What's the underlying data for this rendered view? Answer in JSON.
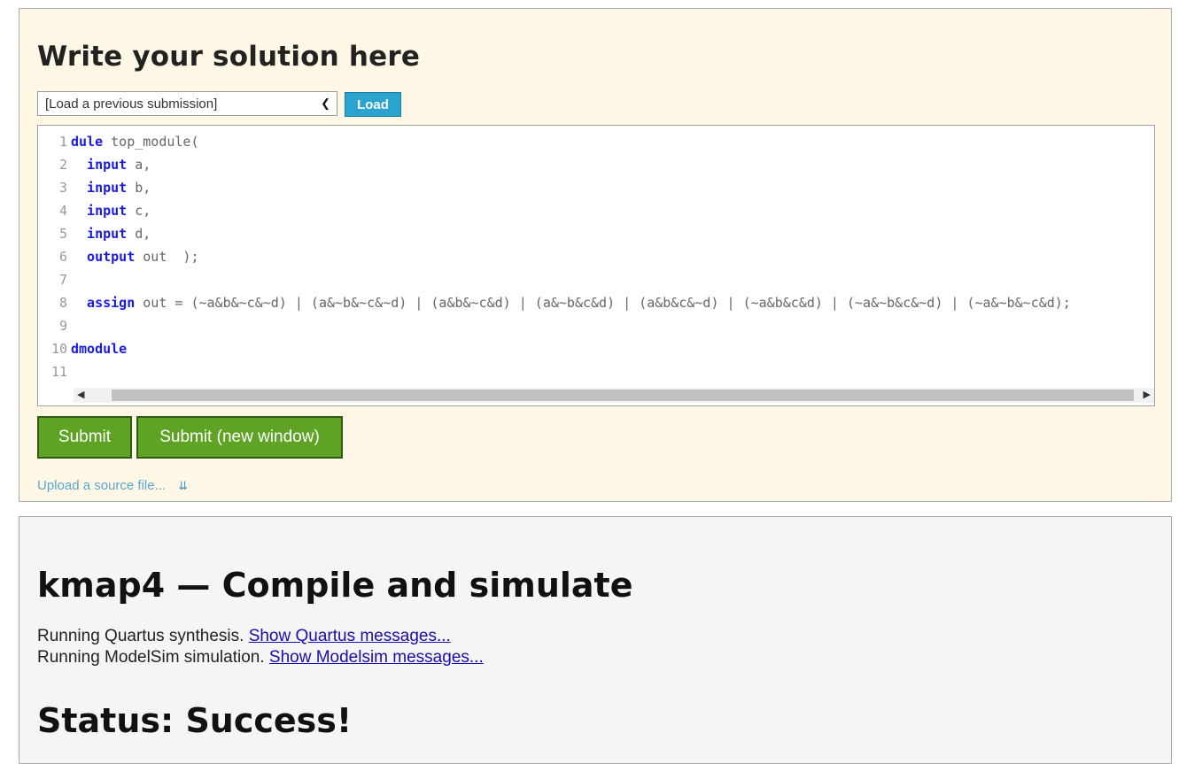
{
  "solution": {
    "heading": "Write your solution here",
    "load_select_value": "[Load a previous submission]",
    "load_button": "Load",
    "code_lines": [
      {
        "num": "1",
        "kw": "dule",
        "text": " top_module("
      },
      {
        "num": "2",
        "kw": "  input",
        "text": " a,"
      },
      {
        "num": "3",
        "kw": "  input",
        "text": " b,"
      },
      {
        "num": "4",
        "kw": "  input",
        "text": " c,"
      },
      {
        "num": "5",
        "kw": "  input",
        "text": " d,"
      },
      {
        "num": "6",
        "kw": "  output",
        "text": " out  );"
      },
      {
        "num": "7",
        "kw": "",
        "text": ""
      },
      {
        "num": "8",
        "kw": "  assign",
        "text": " out = (~a&b&~c&~d) | (a&~b&~c&~d) | (a&b&~c&d) | (a&~b&c&d) | (a&b&c&~d) | (~a&b&c&d) | (~a&~b&c&~d) | (~a&~b&~c&d);"
      },
      {
        "num": "9",
        "kw": "",
        "text": ""
      },
      {
        "num": "10",
        "kw": "dmodule",
        "text": ""
      },
      {
        "num": "11",
        "kw": "",
        "text": ""
      }
    ],
    "submit_button": "Submit",
    "submit_new_window_button": "Submit (new window)",
    "upload_link": "Upload a source file...",
    "upload_icon": "double-chevron-down-icon"
  },
  "result": {
    "heading": "kmap4 — Compile and simulate",
    "quartus_text": "Running Quartus synthesis. ",
    "quartus_link": "Show Quartus messages...",
    "modelsim_text": "Running ModelSim simulation. ",
    "modelsim_link": "Show Modelsim messages...",
    "status": "Status: Success!"
  },
  "colors": {
    "solution_bg": "#fff7e6",
    "result_bg": "#f5f5f5",
    "submit_green": "#5ea324",
    "load_blue": "#2aa4cf",
    "keyword_blue": "#1a1ae6",
    "link_blue": "#1a0dab"
  }
}
